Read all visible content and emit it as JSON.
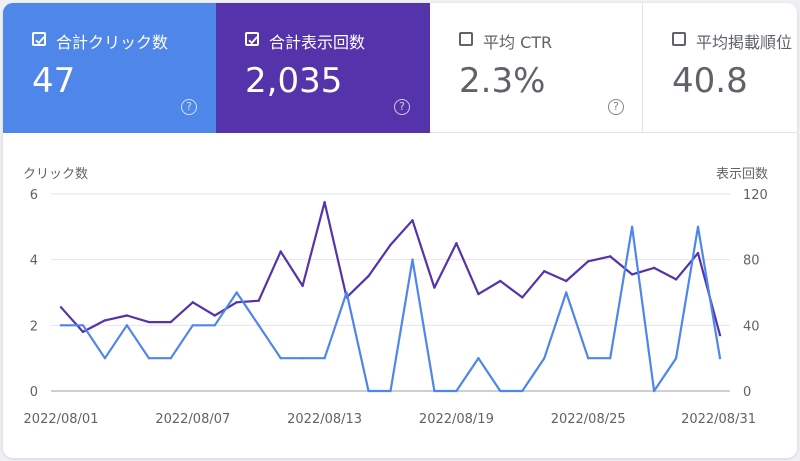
{
  "metrics": {
    "clicks": {
      "label": "合計クリック数",
      "value": "47",
      "checked": true,
      "help": "?"
    },
    "impressions": {
      "label": "合計表示回数",
      "value": "2,035",
      "checked": true,
      "help": "?"
    },
    "ctr": {
      "label": "平均 CTR",
      "value": "2.3%",
      "checked": false,
      "help": "?"
    },
    "position": {
      "label": "平均掲載順位",
      "value": "40.8",
      "checked": false
    }
  },
  "colors": {
    "clicks": "#4e86ea",
    "impressions": "#5533aa",
    "grid": "#e3e5e8",
    "axis_text": "#5f6368"
  },
  "chart_data": {
    "type": "line",
    "y_left_label": "クリック数",
    "y_right_label": "表示回数",
    "x": [
      "2022/08/01",
      "2022/08/02",
      "2022/08/03",
      "2022/08/04",
      "2022/08/05",
      "2022/08/06",
      "2022/08/07",
      "2022/08/08",
      "2022/08/09",
      "2022/08/10",
      "2022/08/11",
      "2022/08/12",
      "2022/08/13",
      "2022/08/14",
      "2022/08/15",
      "2022/08/16",
      "2022/08/17",
      "2022/08/18",
      "2022/08/19",
      "2022/08/20",
      "2022/08/21",
      "2022/08/22",
      "2022/08/23",
      "2022/08/24",
      "2022/08/25",
      "2022/08/26",
      "2022/08/27",
      "2022/08/28",
      "2022/08/29",
      "2022/08/30",
      "2022/08/31"
    ],
    "x_tick_labels": [
      "2022/08/01",
      "2022/08/07",
      "2022/08/13",
      "2022/08/19",
      "2022/08/25",
      "2022/08/31"
    ],
    "y_left_ticks": [
      0,
      2,
      4,
      6
    ],
    "y_left_lim": [
      0,
      6
    ],
    "y_right_ticks": [
      0,
      40,
      80,
      120
    ],
    "y_right_lim": [
      0,
      120
    ],
    "grid": true,
    "series": [
      {
        "name": "クリック数",
        "axis": "left",
        "values": [
          2,
          2,
          1,
          2,
          1,
          1,
          2,
          2,
          3,
          2,
          1,
          1,
          1,
          3,
          0,
          0,
          4,
          0,
          0,
          1,
          0,
          0,
          1,
          3,
          1,
          1,
          5,
          0,
          1,
          5,
          1
        ]
      },
      {
        "name": "表示回数",
        "axis": "right",
        "values": [
          51,
          36,
          43,
          46,
          42,
          42,
          54,
          46,
          54,
          55,
          85,
          64,
          115,
          57,
          70,
          89,
          104,
          63,
          90,
          59,
          67,
          57,
          73,
          67,
          79,
          82,
          71,
          75,
          68,
          84,
          34
        ]
      }
    ]
  }
}
